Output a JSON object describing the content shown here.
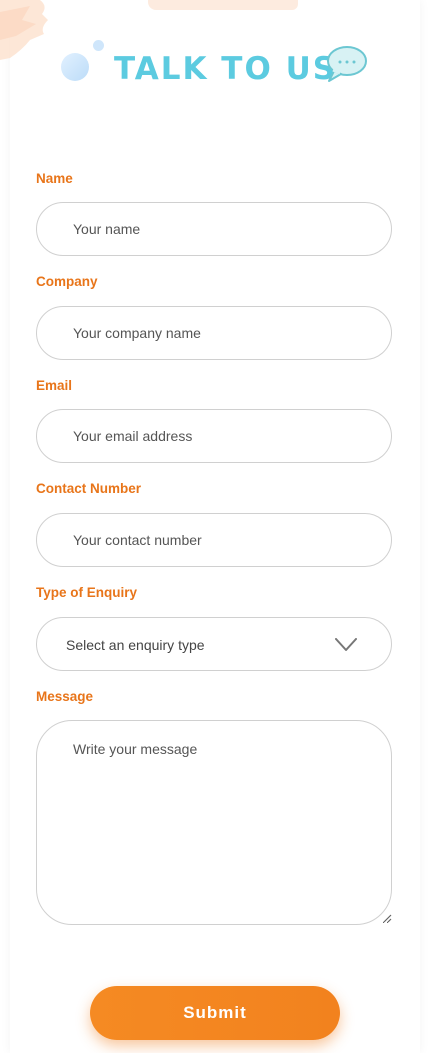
{
  "header": {
    "title": "TALK TO US",
    "title_color": "#5ccbe0"
  },
  "accent_color": "#e8751a",
  "form": {
    "name": {
      "label": "Name",
      "placeholder": "Your name",
      "value": ""
    },
    "company": {
      "label": "Company",
      "placeholder": "Your company name",
      "value": ""
    },
    "email": {
      "label": "Email",
      "placeholder": "Your email address",
      "value": ""
    },
    "contact": {
      "label": "Contact Number",
      "placeholder": "Your contact number",
      "value": ""
    },
    "enquiry": {
      "label": "Type of Enquiry",
      "selected": "Select an enquiry type"
    },
    "message": {
      "label": "Message",
      "placeholder": "Write your message",
      "value": ""
    },
    "submit_label": "Submit"
  },
  "icons": {
    "decor_bubble": "bubble-dots",
    "chat": "chat-bubble-icon",
    "select": "chevron-down-icon"
  }
}
